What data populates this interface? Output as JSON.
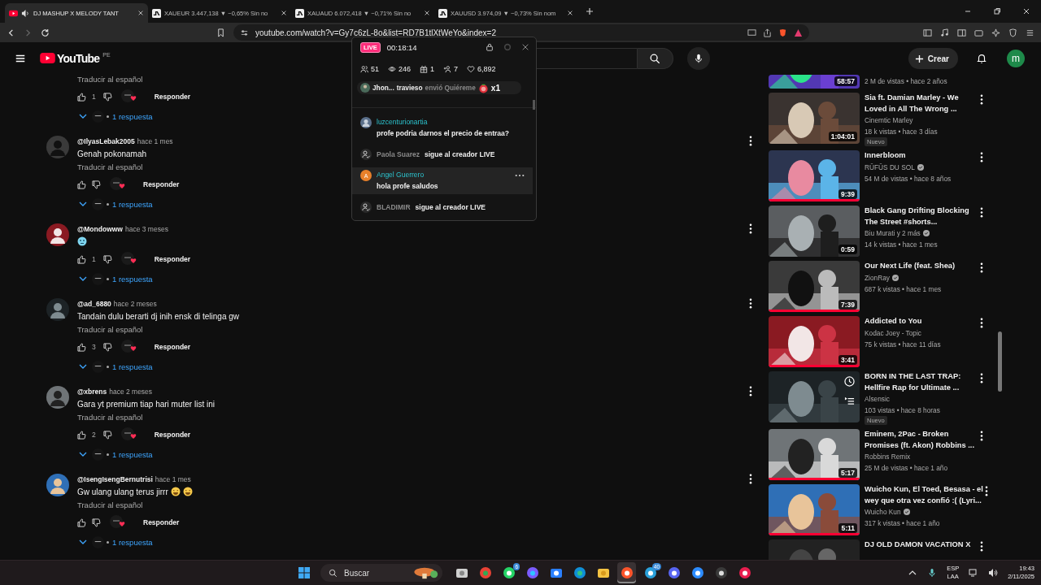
{
  "browser": {
    "tabs": [
      {
        "kind": "youtube",
        "title": "DJ MASHUP X MELODY TANT",
        "selected": true,
        "audio": true
      },
      {
        "kind": "chart",
        "title": "XAUEUR 3.447,138 ▼ −0,65% Sin no",
        "selected": false,
        "audio": false
      },
      {
        "kind": "chart",
        "title": "XAUAUD 6.072,418 ▼ −0,71% Sin no",
        "selected": false,
        "audio": false
      },
      {
        "kind": "chart",
        "title": "XAUUSD 3.974,09 ▼ −0,73% Sin nom",
        "selected": false,
        "audio": false
      }
    ],
    "address": "youtube.com/watch?v=Gy7c6zL-8o&list=RD7B1tlXtWeYo&index=2"
  },
  "header": {
    "logo": "YouTube",
    "region": "PE",
    "create": "Crear",
    "avatar": "m"
  },
  "comments": [
    {
      "kind": "text",
      "translate": "Traducir al español",
      "likes": "1",
      "reply": "Responder",
      "replies": "1 respuesta"
    },
    {
      "kind": "text",
      "author": "@IlyasLebak2005",
      "time": "hace 1 mes",
      "text": "Genah pokonamah",
      "translate": "Traducir al español",
      "reply": "Responder",
      "replies": "1 respuesta"
    },
    {
      "kind": "emoji",
      "author": "@Mondowww",
      "time": "hace 3 meses",
      "likes": "1",
      "reply": "Responder",
      "replies": "1 respuesta"
    },
    {
      "kind": "text",
      "author": "@ad_6880",
      "time": "hace 2 meses",
      "text": "Tandain dulu berarti dj inih ensk di telinga gw",
      "translate": "Traducir al español",
      "likes": "3",
      "reply": "Responder",
      "replies": "1 respuesta"
    },
    {
      "kind": "text",
      "author": "@xbrens",
      "time": "hace 2 meses",
      "text": "Gara yt premium tiap hari muter list ini",
      "translate": "Traducir al español",
      "likes": "2",
      "reply": "Responder",
      "replies": "1 respuesta"
    },
    {
      "kind": "text_emoji",
      "author": "@IsengIsengBernutrisi",
      "time": "hace 1 mes",
      "text": "Gw ulang ulang terus jirrr",
      "translate": "Traducir al español",
      "reply": "Responder",
      "replies": "1 respuesta"
    }
  ],
  "live": {
    "badge": "LIVE",
    "time": "00:18:14",
    "stats": [
      {
        "kind": "viewers",
        "value": "51"
      },
      {
        "kind": "views",
        "value": "246"
      },
      {
        "kind": "gifts",
        "value": "1"
      },
      {
        "kind": "follows",
        "value": "7"
      },
      {
        "kind": "likes",
        "value": "6,892"
      }
    ],
    "gift": {
      "name": "Jhon...",
      "name2": "travieso",
      "action": "envió Quiéreme",
      "count": "x1"
    },
    "chat": [
      {
        "kind": "message",
        "name": "luzcenturionartia",
        "text": "profe podria darnos el precio de entraa?",
        "hovered": false
      },
      {
        "kind": "follow",
        "name": "Paola Suarez",
        "text": "sigue al creador LIVE",
        "hovered": false
      },
      {
        "kind": "message",
        "name": "Angel Guerrero",
        "initial": "A",
        "text": "hola profe saludos",
        "hovered": true
      },
      {
        "kind": "follow",
        "name": "BLADIMIR",
        "text": "sigue al creador LIVE",
        "hovered": false
      }
    ]
  },
  "related": [
    {
      "meta": "2 M de vistas • hace 2 años",
      "duration": "58:57",
      "verified": false,
      "watched": false,
      "hover": false
    },
    {
      "title": [
        "Sia ft. Damian Marley - We",
        "Loved in All The Wrong ..."
      ],
      "channel": "Cinemtic Marley",
      "meta": "18 k vistas • hace 3 días",
      "badge": "Nuevo",
      "duration": "1:04:01",
      "verified": false,
      "watched": false,
      "hover": false
    },
    {
      "title": [
        "Innerbloom"
      ],
      "channel": "RÜFÜS DU SOL",
      "meta": "54 M de vistas • hace 8 años",
      "duration": "9:39",
      "verified": true,
      "watched": true,
      "hover": false
    },
    {
      "title": [
        "Black Gang Drifting Blocking",
        "The Street #shorts..."
      ],
      "channel": "Biu Murati y 2 más",
      "meta": "14 k vistas • hace 1 mes",
      "duration": "0:59",
      "verified": true,
      "watched": false,
      "hover": false
    },
    {
      "title": [
        "Our Next Life (feat. Shea)"
      ],
      "channel": "ZionRay",
      "meta": "687 k vistas • hace 1 mes",
      "duration": "7:39",
      "verified": true,
      "watched": true,
      "hover": false
    },
    {
      "title": [
        "Addicted to You"
      ],
      "channel": "Kodac Joey - Topic",
      "meta": "75 k vistas • hace 11 días",
      "duration": "3:41",
      "verified": false,
      "watched": true,
      "hover": false
    },
    {
      "title": [
        "BORN IN THE LAST TRAP:",
        "Hellfire Rap for Ultimate ..."
      ],
      "channel": "Alsensic",
      "meta": "103 vistas • hace 8 horas",
      "badge": "Nuevo",
      "verified": false,
      "watched": false,
      "hover": true
    },
    {
      "title": [
        "Eminem, 2Pac - Broken",
        "Promises (ft. Akon) Robbins ..."
      ],
      "channel": "Robbins Remix",
      "meta": "25 M de vistas • hace 1 año",
      "duration": "5:17",
      "verified": false,
      "watched": true,
      "hover": false
    },
    {
      "title": [
        "Wuicho Kun, El Toed, Besasa - el",
        "wey que otra vez confió :( (Lyri..."
      ],
      "channel": "Wuicho Kun",
      "meta": "317 k vistas • hace 1 año",
      "duration": "5:11",
      "verified": true,
      "watched": true,
      "hover": false
    },
    {
      "title": [
        "DJ OLD DAMON VACATION X"
      ],
      "verified": false,
      "watched": false,
      "hover": false
    }
  ],
  "taskbar": {
    "search": "Buscar",
    "apps": [
      {
        "kind": "files",
        "selected": false
      },
      {
        "kind": "chrome",
        "selected": false
      },
      {
        "kind": "whatsapp",
        "badge": "6",
        "selected": false
      },
      {
        "kind": "copilot",
        "selected": false
      },
      {
        "kind": "store",
        "selected": false
      },
      {
        "kind": "edge",
        "selected": false
      },
      {
        "kind": "folder",
        "selected": false
      },
      {
        "kind": "brave",
        "selected": true
      },
      {
        "kind": "telegram",
        "badge": "40",
        "selected": false
      },
      {
        "kind": "discord",
        "selected": false
      },
      {
        "kind": "zoom",
        "selected": false
      },
      {
        "kind": "obs",
        "selected": false
      },
      {
        "kind": "tiktok",
        "selected": false
      }
    ],
    "lang": "ESP",
    "layout": "LAA",
    "time": "19:43",
    "date": "2/11/2025"
  }
}
